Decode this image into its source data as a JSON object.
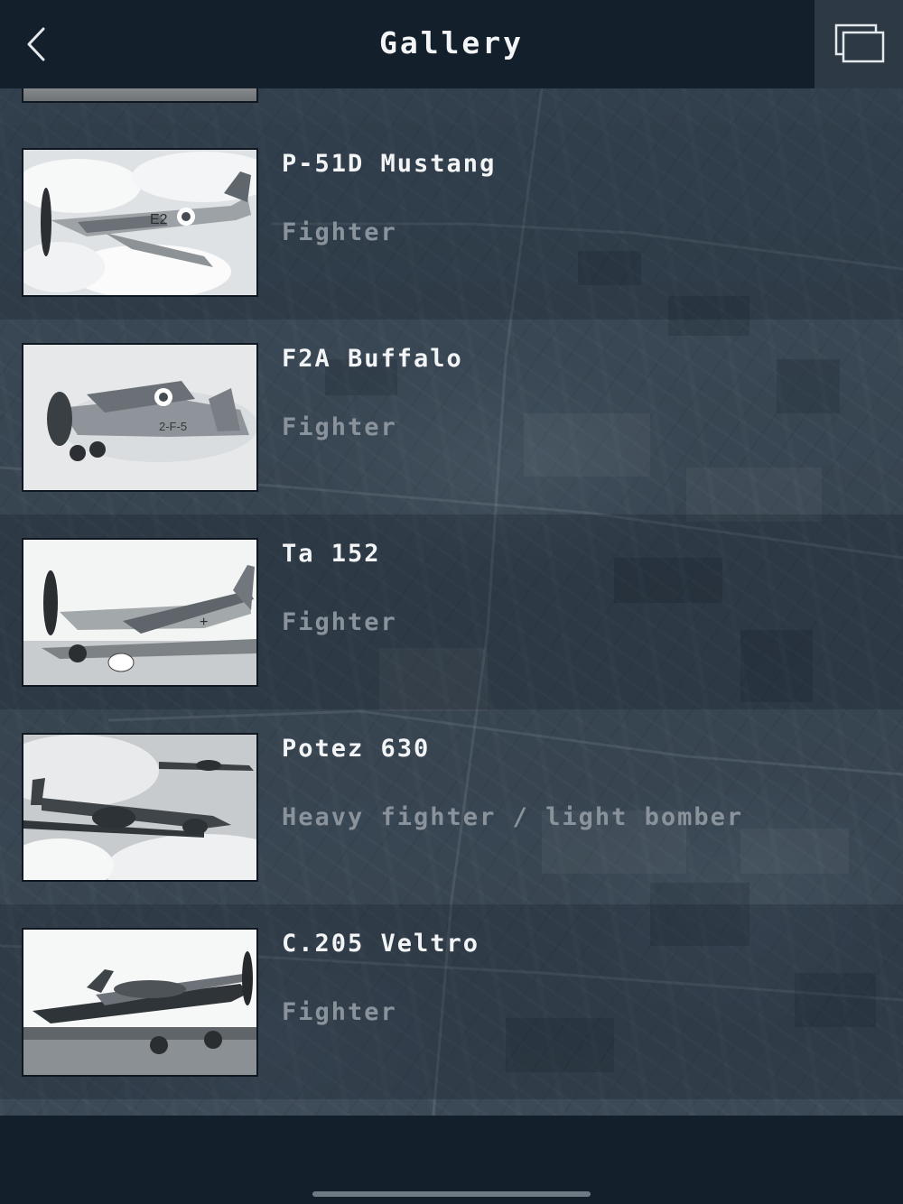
{
  "header": {
    "title": "Gallery",
    "back_icon": "chevron-left-icon",
    "windows_icon": "windows-stack-icon"
  },
  "aircraft": [
    {
      "name": "P-51D Mustang",
      "role": "Fighter"
    },
    {
      "name": "F2A Buffalo",
      "role": "Fighter"
    },
    {
      "name": "Ta 152",
      "role": "Fighter"
    },
    {
      "name": "Potez 630",
      "role": "Heavy fighter / light bomber"
    },
    {
      "name": "C.205 Veltro",
      "role": "Fighter"
    }
  ],
  "colors": {
    "header_bg": "#13202c",
    "title_text": "#f2f4f6",
    "subtitle_text": "#8a939b",
    "windows_button_bg": "#2d3945"
  }
}
